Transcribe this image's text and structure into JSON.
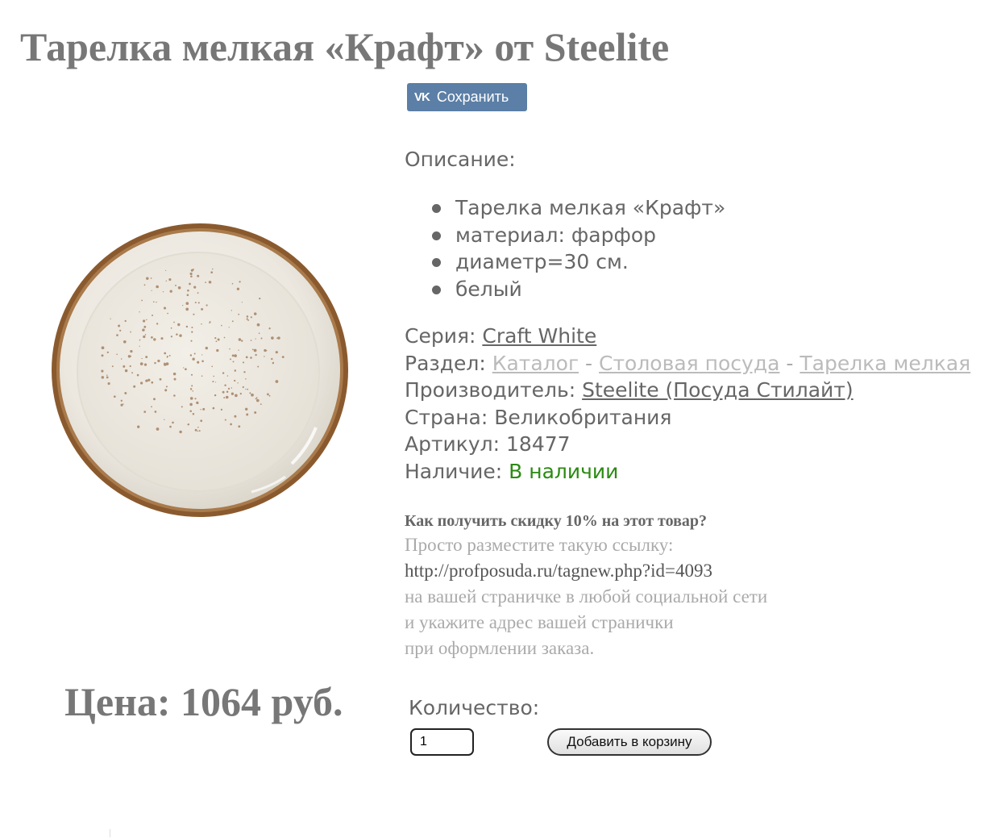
{
  "page": {
    "title": "Тарелка мелкая «Крафт» от Steelite"
  },
  "share": {
    "logo_text": "VK",
    "label": "Сохранить",
    "color": "#5b7fa6"
  },
  "product_image": {
    "icon": "plate-image"
  },
  "description": {
    "label": "Описание:",
    "items": [
      "Тарелка мелкая «Крафт»",
      "материал: фарфор",
      "диаметр=30 см.",
      "белый"
    ]
  },
  "info": {
    "series_label": "Серия: ",
    "series_value": "Craft White",
    "section_label": "Раздел: ",
    "section_links": [
      "Каталог",
      "Столовая посуда",
      "Тарелка мелкая"
    ],
    "section_separator": " - ",
    "maker_label": "Производитель: ",
    "maker_value": "Steelite (Посуда Стилайт)",
    "country_label": "Страна: ",
    "country_value": "Великобритания",
    "sku_label": "Артикул: ",
    "sku_value": "18477",
    "stock_label": "Наличие: ",
    "stock_value": "В наличии",
    "stock_color": "#2a8a12"
  },
  "promo": {
    "question": "Как получить скидку 10% на этот товар?",
    "line1": "Просто разместите такую ссылку:",
    "url": "http://profposuda.ru/tagnew.php?id=4093",
    "line3": "на вашей страничке в любой социальной сети",
    "line4": "и укажите адрес вашей странички",
    "line5": "при оформлении заказа."
  },
  "price": {
    "text": "Цена: 1064 руб."
  },
  "order": {
    "quantity_label": "Количество:",
    "quantity_value": "1",
    "add_button": "Добавить в корзину"
  }
}
